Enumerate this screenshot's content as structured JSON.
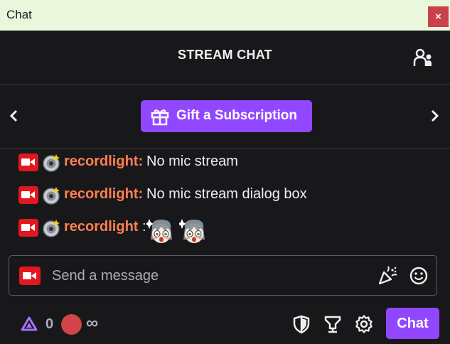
{
  "window": {
    "title": "Chat",
    "close_glyph": "×"
  },
  "header": {
    "title": "STREAM CHAT",
    "users_icon": "community-icon"
  },
  "gift": {
    "label": "Gift a Subscription",
    "icon": "gift-icon",
    "prev_icon": "chevron-left-icon",
    "next_icon": "chevron-right-icon"
  },
  "messages": [
    {
      "user": "recordlight",
      "text": "No mic stream"
    },
    {
      "user": "recordlight",
      "text": "No mic stream dialog box"
    },
    {
      "user": "recordlight",
      "text": "",
      "emotes": [
        "anime-girl-emote",
        "anime-girl-emote"
      ]
    }
  ],
  "input": {
    "placeholder": "Send a message"
  },
  "footer": {
    "points": "0",
    "infinity": "∞",
    "chat_label": "Chat"
  },
  "colors": {
    "accent": "#9147ff",
    "username": "#ff7f50",
    "cam_badge": "#e2171f",
    "bg": "#18181b"
  }
}
